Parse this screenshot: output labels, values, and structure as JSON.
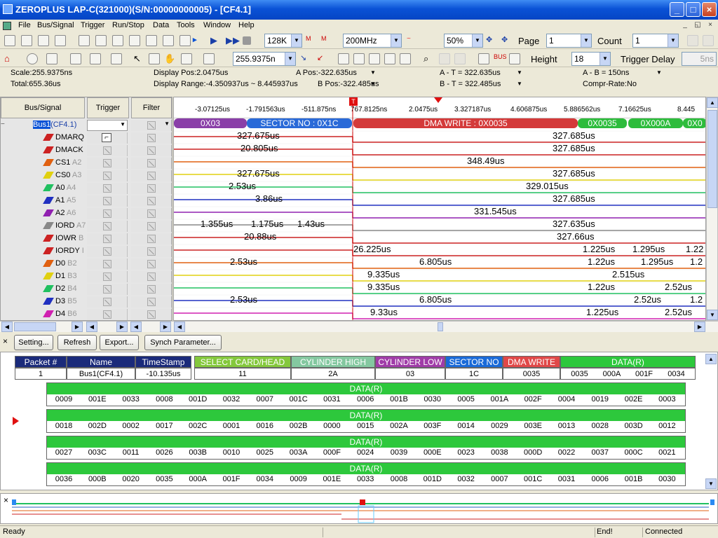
{
  "window": {
    "title": "ZEROPLUS LAP-C(321000)(S/N:00000000005) - [CF4.1]"
  },
  "menu": [
    "File",
    "Bus/Signal",
    "Trigger",
    "Run/Stop",
    "Data",
    "Tools",
    "Window",
    "Help"
  ],
  "toolbar": {
    "memory": "128K",
    "rate": "200MHz",
    "zoom": "50%",
    "page_label": "Page",
    "page_value": "1",
    "count_label": "Count",
    "count_value": "1",
    "scale_combo": "255.9375n",
    "height_label": "Height",
    "height_value": "18",
    "trigger_delay_label": "Trigger Delay",
    "trigger_delay_value": "5ns"
  },
  "info": {
    "scale": "Scale:255.9375ns",
    "total": "Total:655.36us",
    "display_pos": "Display Pos:2.0475us",
    "display_range": "Display Range:-4.350937us ~ 8.445937us",
    "a_pos": "A Pos:-322.635us",
    "b_pos": "B Pos:-322.485us",
    "a_t": "A - T = 322.635us",
    "b_t": "B - T = 322.485us",
    "a_b": "A - B = 150ns",
    "compr": "Compr-Rate:No"
  },
  "columns": {
    "bus_signal": "Bus/Signal",
    "trigger": "Trigger",
    "filter": "Filter"
  },
  "signals": [
    {
      "name": "Bus1",
      "pin": "(CF4.1)",
      "color": "#3355cc"
    },
    {
      "name": "DMARQ",
      "pin": "",
      "color": "#cc2222"
    },
    {
      "name": "DMACK",
      "pin": "",
      "color": "#cc2222"
    },
    {
      "name": "CS1",
      "pin": "A2",
      "color": "#e06010"
    },
    {
      "name": "CS0",
      "pin": "A3",
      "color": "#e0d010"
    },
    {
      "name": "A0",
      "pin": "A4",
      "color": "#20c060"
    },
    {
      "name": "A1",
      "pin": "A5",
      "color": "#2030c0"
    },
    {
      "name": "A2",
      "pin": "A6",
      "color": "#9020b0"
    },
    {
      "name": "IORD",
      "pin": "A7",
      "color": "#888888"
    },
    {
      "name": "IOWR",
      "pin": "B",
      "color": "#cc2222"
    },
    {
      "name": "IORDY",
      "pin": "I",
      "color": "#cc2222"
    },
    {
      "name": "D0",
      "pin": "B2",
      "color": "#e06010"
    },
    {
      "name": "D1",
      "pin": "B3",
      "color": "#e0d010"
    },
    {
      "name": "D2",
      "pin": "B4",
      "color": "#20c060"
    },
    {
      "name": "D3",
      "pin": "B5",
      "color": "#2030c0"
    },
    {
      "name": "D4",
      "pin": "B6",
      "color": "#d020b0"
    }
  ],
  "ruler_ticks": [
    "-3.07125us",
    "-1.791563us",
    "-511.875ns",
    "767.8125ns",
    "2.0475us",
    "3.327187us",
    "4.606875us",
    "5.886562us",
    "7.16625us",
    "8.445"
  ],
  "bus_segments": [
    "0X03",
    "SECTOR NO : 0X1C",
    "DMA WRITE : 0X0035",
    "0X0035",
    "0X000A",
    "0X0"
  ],
  "wave_labels": [
    "327.675us",
    "327.685us",
    "20.805us",
    "327.685us",
    "348.49us",
    "327.675us",
    "327.685us",
    "2.53us",
    "329.015us",
    "3.86us",
    "327.685us",
    "331.545us",
    "1.355us",
    "1.175us",
    "1.43us",
    "327.635us",
    "20.88us",
    "327.66us",
    "26.225us",
    "1.225us",
    "1.295us",
    "1.22",
    "2.53us",
    "6.805us",
    "1.22us",
    "1.295us",
    "1.2",
    "9.335us",
    "2.515us",
    "9.335us",
    "1.22us",
    "2.52us",
    "2.53us",
    "6.805us",
    "2.52us",
    "1.2",
    "9.33us",
    "1.225us",
    "2.52us"
  ],
  "packet_toolbar": {
    "setting": "Setting...",
    "refresh": "Refresh",
    "export": "Export...",
    "synch": "Synch Parameter..."
  },
  "packet": {
    "headers": [
      "Packet #",
      "Name",
      "TimeStamp",
      "SELECT CARD/HEAD",
      "CYLINDER HIGH",
      "CYLINDER LOW",
      "SECTOR NO",
      "DMA WRITE",
      "DATA(R)"
    ],
    "row": [
      "1",
      "Bus1(CF4.1)",
      "-10.135us",
      "11",
      "2A",
      "03",
      "1C",
      "0035"
    ],
    "first_data": [
      "0035",
      "000A",
      "001F",
      "0034"
    ],
    "data_title": "DATA(R)",
    "data_rows": [
      [
        "0009",
        "001E",
        "0033",
        "0008",
        "001D",
        "0032",
        "0007",
        "001C",
        "0031",
        "0006",
        "001B",
        "0030",
        "0005",
        "001A",
        "002F",
        "0004",
        "0019",
        "002E",
        "0003"
      ],
      [
        "0018",
        "002D",
        "0002",
        "0017",
        "002C",
        "0001",
        "0016",
        "002B",
        "0000",
        "0015",
        "002A",
        "003F",
        "0014",
        "0029",
        "003E",
        "0013",
        "0028",
        "003D",
        "0012"
      ],
      [
        "0027",
        "003C",
        "0011",
        "0026",
        "003B",
        "0010",
        "0025",
        "003A",
        "000F",
        "0024",
        "0039",
        "000E",
        "0023",
        "0038",
        "000D",
        "0022",
        "0037",
        "000C",
        "0021"
      ],
      [
        "0036",
        "000B",
        "0020",
        "0035",
        "000A",
        "001F",
        "0034",
        "0009",
        "001E",
        "0033",
        "0008",
        "001D",
        "0032",
        "0007",
        "001C",
        "0031",
        "0006",
        "001B",
        "0030"
      ]
    ]
  },
  "status": {
    "ready": "Ready",
    "end": "End!",
    "connected": "Connected"
  },
  "markers": {
    "t": "T",
    "b": "B"
  },
  "icons": {
    "cursor_char": "1"
  },
  "colors": {
    "accent": "#0a52d6",
    "header_green": "#2dc83c"
  }
}
